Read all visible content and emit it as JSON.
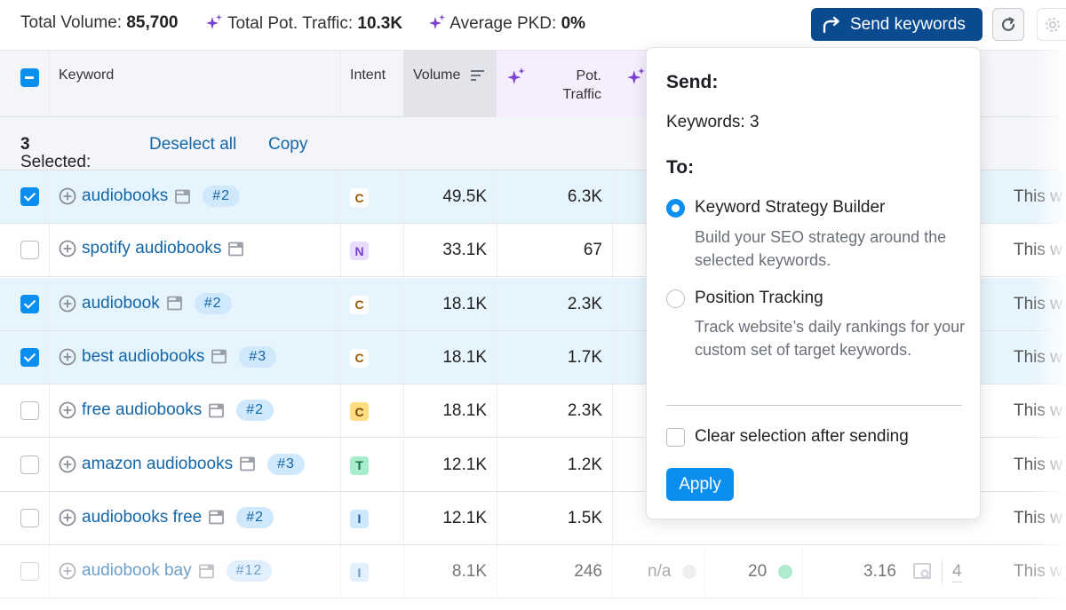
{
  "summary": {
    "total_volume_label": "Total Volume:",
    "total_volume_value": "85,700",
    "total_pot_traffic_label": "Total Pot. Traffic:",
    "total_pot_traffic_value": "10.3K",
    "average_pkd_label": "Average PKD:",
    "average_pkd_value": "0%",
    "send_keywords_label": "Send keywords",
    "accent_color": "#0a4a8f",
    "sparkle_color": "#7b3fd0"
  },
  "table": {
    "headers": {
      "keyword": "Keyword",
      "intent": "Intent",
      "volume": "Volume",
      "pot_traffic_line1": "Pot.",
      "pot_traffic_line2": "Traffic"
    },
    "selection": {
      "selected_label": "Selected:",
      "selected_count": "3",
      "deselect_all": "Deselect all",
      "copy": "Copy"
    },
    "rows": [
      {
        "keyword": "audiobooks",
        "badge": "#2",
        "intent": "C",
        "volume": "49.5K",
        "pot_traffic": "6.3K",
        "checked": true,
        "trailing": "This w"
      },
      {
        "keyword": "spotify audiobooks",
        "badge": "",
        "intent": "N",
        "volume": "33.1K",
        "pot_traffic": "67",
        "checked": false,
        "trailing": "This w"
      },
      {
        "keyword": "audiobook",
        "badge": "#2",
        "intent": "C",
        "volume": "18.1K",
        "pot_traffic": "2.3K",
        "checked": true,
        "trailing": "This w"
      },
      {
        "keyword": "best audiobooks",
        "badge": "#3",
        "intent": "C",
        "volume": "18.1K",
        "pot_traffic": "1.7K",
        "checked": true,
        "trailing": "This w"
      },
      {
        "keyword": "free audiobooks",
        "badge": "#2",
        "intent": "C",
        "volume": "18.1K",
        "pot_traffic": "2.3K",
        "checked": false,
        "trailing": "This w"
      },
      {
        "keyword": "amazon audiobooks",
        "badge": "#3",
        "intent": "T",
        "volume": "12.1K",
        "pot_traffic": "1.2K",
        "checked": false,
        "trailing": "This w"
      },
      {
        "keyword": "audiobooks free",
        "badge": "#2",
        "intent": "I",
        "volume": "12.1K",
        "pot_traffic": "1.5K",
        "checked": false,
        "trailing": "This w"
      },
      {
        "keyword": "audiobook bay",
        "badge": "#12",
        "intent": "I",
        "volume": "8.1K",
        "pot_traffic": "246",
        "checked": false,
        "trailing": "This w",
        "extra": {
          "trend": "n/a",
          "kd": "20",
          "cpc": "3.16",
          "serp_features": "4"
        }
      }
    ],
    "intent_colors": {
      "C": {
        "bg": "#fff4dc",
        "fg": "#9a5a00"
      },
      "C_strong": {
        "bg": "#ffdd80",
        "fg": "#7a4800"
      },
      "N": {
        "bg": "#eadcfd",
        "fg": "#7a3fd0"
      },
      "T": {
        "bg": "#a8eccb",
        "fg": "#0f6e47"
      },
      "I": {
        "bg": "#cfe8fb",
        "fg": "#135a9a"
      }
    }
  },
  "popover": {
    "send_heading": "Send:",
    "keywords_count": "Keywords: 3",
    "to_heading": "To:",
    "options": [
      {
        "label": "Keyword Strategy Builder",
        "description": "Build your SEO strategy around the selected keywords.",
        "selected": true
      },
      {
        "label": "Position Tracking",
        "description": "Track website’s daily rankings for your custom set of target keywords.",
        "selected": false
      }
    ],
    "clear_selection_label": "Clear selection after sending",
    "clear_selection_checked": false,
    "apply_label": "Apply",
    "apply_color": "#0a8ff0"
  }
}
